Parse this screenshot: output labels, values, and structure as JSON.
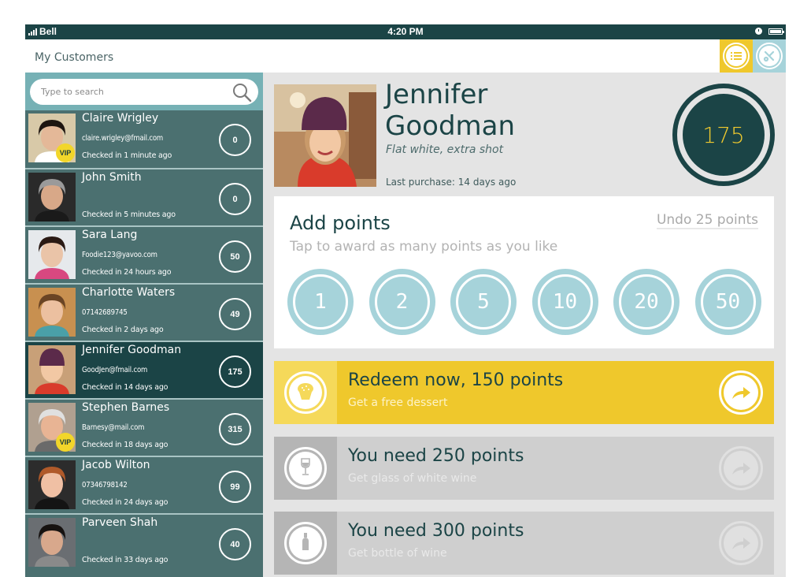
{
  "status_bar": {
    "carrier": "Bell",
    "time": "4:20 PM"
  },
  "header": {
    "title": "My Customers",
    "buttons": [
      {
        "icon": "list-icon",
        "color": "#efc82c"
      },
      {
        "icon": "tools-icon",
        "color": "#a6d3da"
      }
    ]
  },
  "search": {
    "placeholder": "Type to search",
    "value": ""
  },
  "customers": [
    {
      "name": "Claire Wrigley",
      "contact": "claire.wrigley@fmail.com",
      "checked_in": "Checked in 1 minute ago",
      "points": "0",
      "vip": true,
      "vip_label": "VIP",
      "selected": false
    },
    {
      "name": "John Smith",
      "contact": "",
      "checked_in": "Checked in 5 minutes ago",
      "points": "0",
      "vip": false,
      "selected": false
    },
    {
      "name": "Sara Lang",
      "contact": "Foodie123@yavoo.com",
      "checked_in": "Checked in 24 hours ago",
      "points": "50",
      "vip": false,
      "selected": false
    },
    {
      "name": "Charlotte Waters",
      "contact": "07142689745",
      "checked_in": "Checked in 2 days ago",
      "points": "49",
      "vip": false,
      "selected": false
    },
    {
      "name": "Jennifer Goodman",
      "contact": "GoodJen@fmail.com",
      "checked_in": "Checked in 14 days ago",
      "points": "175",
      "vip": false,
      "selected": true
    },
    {
      "name": "Stephen Barnes",
      "contact": "Barnesy@mail.com",
      "checked_in": "Checked in 18 days ago",
      "points": "315",
      "vip": true,
      "vip_label": "VIP",
      "selected": false
    },
    {
      "name": "Jacob Wilton",
      "contact": "07346798142",
      "checked_in": "Checked in 24 days ago",
      "points": "99",
      "vip": false,
      "selected": false
    },
    {
      "name": "Parveen Shah",
      "contact": "",
      "checked_in": "Checked in 33 days ago",
      "points": "40",
      "vip": false,
      "selected": false
    }
  ],
  "profile": {
    "first_name": "Jennifer",
    "last_name": "Goodman",
    "preference": "Flat white, extra shot",
    "last_purchase": "Last purchase: 14 days ago",
    "points": "175"
  },
  "add_points": {
    "title": "Add points",
    "subtitle": "Tap to award as many points as you like",
    "undo_label": "Undo 25 points",
    "options": [
      "1",
      "2",
      "5",
      "10",
      "20",
      "50"
    ]
  },
  "rewards": [
    {
      "title": "Redeem now, 150 points",
      "subtitle": "Get a free dessert",
      "icon": "cupcake-icon",
      "state": "active"
    },
    {
      "title": "You need 250 points",
      "subtitle": "Get glass of white wine",
      "icon": "wine-glass-icon",
      "state": "locked"
    },
    {
      "title": "You need 300 points",
      "subtitle": "Get bottle of wine",
      "icon": "wine-bottle-icon",
      "state": "locked"
    }
  ],
  "colors": {
    "dark_teal": "#1b4446",
    "sidebar_teal": "#4b7070",
    "light_blue": "#a6d3da",
    "yellow": "#efc82c",
    "grey_bg": "#e4e4e4"
  }
}
